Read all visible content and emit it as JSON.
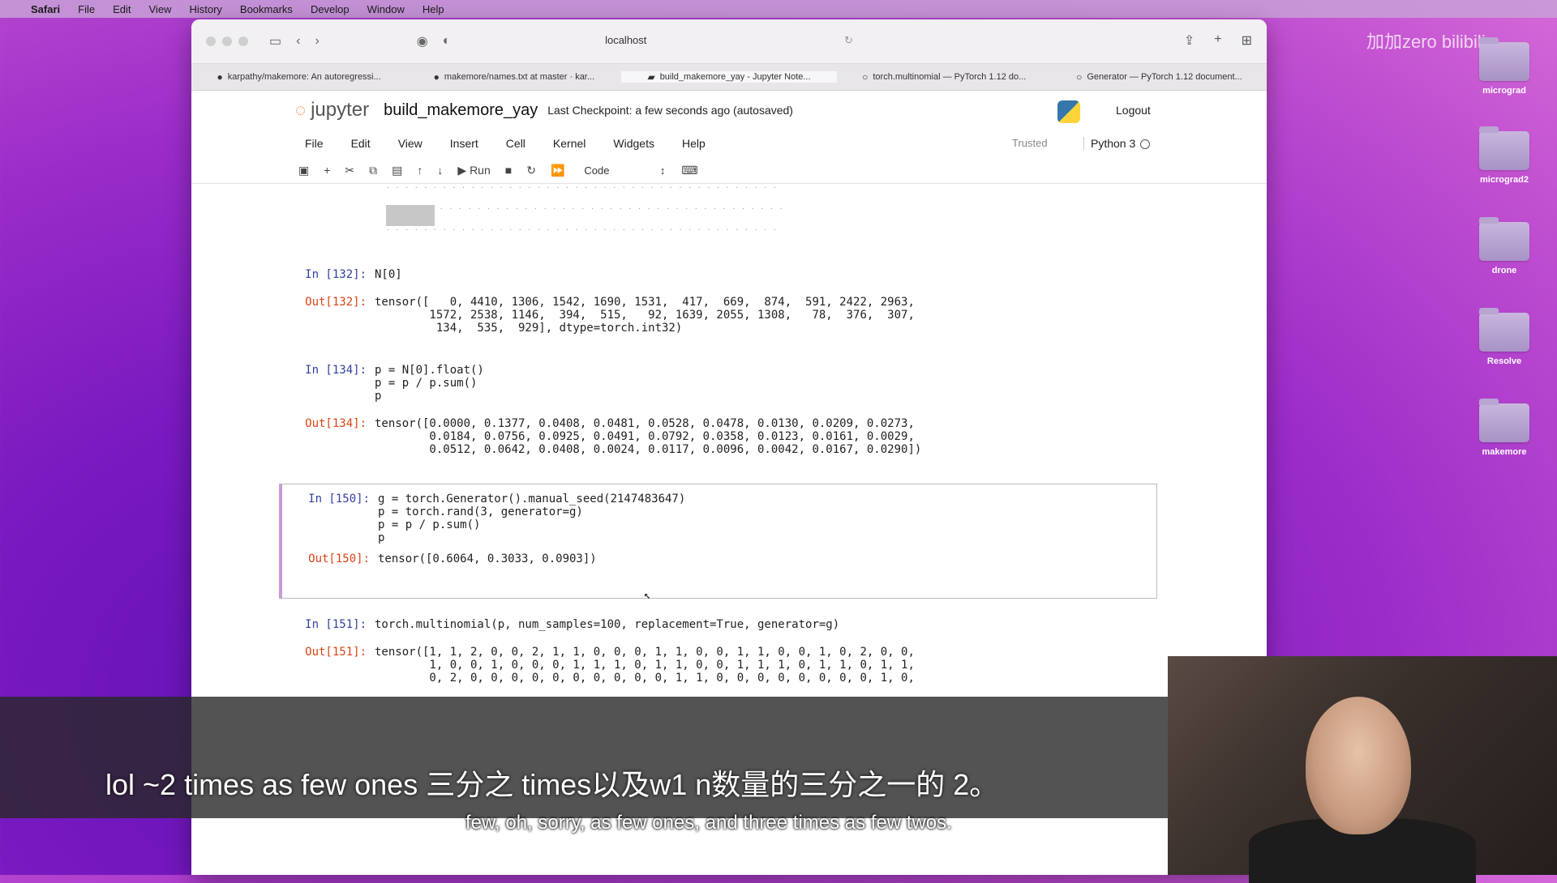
{
  "menubar": {
    "items": [
      "Safari",
      "File",
      "Edit",
      "View",
      "History",
      "Bookmarks",
      "Develop",
      "Window",
      "Help"
    ]
  },
  "desktop": {
    "folders": [
      "micrograd",
      "micrograd2",
      "drone",
      "Resolve",
      "makemore"
    ]
  },
  "browser": {
    "address": "localhost",
    "tabs": [
      "karpathy/makemore: An autoregressi...",
      "makemore/names.txt at master · kar...",
      "build_makemore_yay - Jupyter Note...",
      "torch.multinomial — PyTorch 1.12 do...",
      "Generator — PyTorch 1.12 document..."
    ]
  },
  "jupyter": {
    "logo_text": "jupyter",
    "notebook_name": "build_makemore_yay",
    "checkpoint": "Last Checkpoint: a few seconds ago  (autosaved)",
    "logout": "Logout",
    "menu": [
      "File",
      "Edit",
      "View",
      "Insert",
      "Cell",
      "Kernel",
      "Widgets",
      "Help"
    ],
    "trusted": "Trusted",
    "kernel": "Python 3",
    "run_label": "Run",
    "cell_type": "Code"
  },
  "cells": [
    {
      "in_prompt": "In [132]:",
      "code": [
        "N[0]"
      ],
      "out_prompt": "Out[132]:",
      "output": [
        "tensor([   0, 4410, 1306, 1542, 1690, 1531,  417,  669,  874,  591, 2422, 2963,",
        "        1572, 2538, 1146,  394,  515,   92, 1639, 2055, 1308,   78,  376,  307,",
        "         134,  535,  929], dtype=torch.int32)"
      ]
    },
    {
      "in_prompt": "In [134]:",
      "code": [
        "p = N[0].float()",
        "p = p / p.sum()",
        "p"
      ],
      "out_prompt": "Out[134]:",
      "output": [
        "tensor([0.0000, 0.1377, 0.0408, 0.0481, 0.0528, 0.0478, 0.0130, 0.0209, 0.0273,",
        "        0.0184, 0.0756, 0.0925, 0.0491, 0.0792, 0.0358, 0.0123, 0.0161, 0.0029,",
        "        0.0512, 0.0642, 0.0408, 0.0024, 0.0117, 0.0096, 0.0042, 0.0167, 0.0290])"
      ]
    },
    {
      "in_prompt": "In [150]:",
      "code": [
        "g = torch.Generator().manual_seed(2147483647)",
        "p = torch.rand(3, generator=g)",
        "p = p / p.sum()",
        "p"
      ],
      "out_prompt": "Out[150]:",
      "output": [
        "tensor([0.6064, 0.3033, 0.0903])"
      ]
    },
    {
      "in_prompt": "In [151]:",
      "code": [
        "torch.multinomial(p, num_samples=100, replacement=True, generator=g)"
      ],
      "out_prompt": "Out[151]:",
      "output": [
        "tensor([1, 1, 2, 0, 0, 2, 1, 1, 0, 0, 0, 1, 1, 0, 0, 1, 1, 0, 0, 1, 0, 2, 0, 0,",
        "        1, 0, 0, 1, 0, 0, 0, 1, 1, 1, 0, 1, 1, 0, 0, 1, 1, 1, 0, 1, 1, 0, 1, 1,",
        "        0, 2, 0, 0, 0, 0, 0, 0, 0, 0, 0, 0, 1, 1, 0, 0, 0, 0, 0, 0, 0, 0, 1, 0,"
      ]
    }
  ],
  "subtitles": {
    "line1": "lol ~2 times as few ones 三分之 times以及w1 n数量的三分之一的 2。",
    "line2": "few, oh, sorry, as few ones, and three times as few twos."
  },
  "watermark": "加加zero bilibili"
}
